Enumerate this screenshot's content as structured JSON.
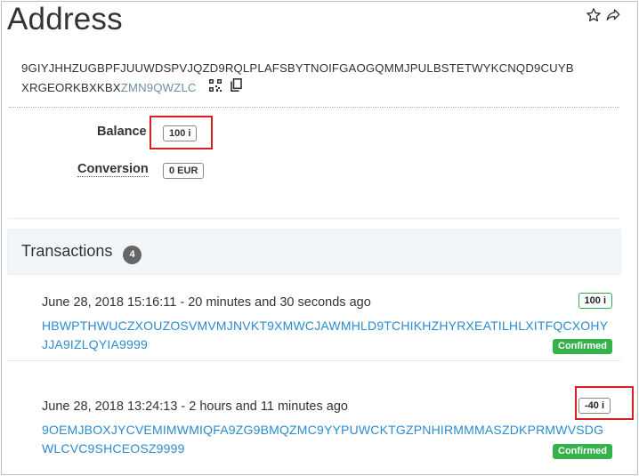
{
  "page": {
    "title": "Address"
  },
  "address": {
    "line1": "9GIYJHHZUGBPFJUUWDSPVJQZD9RQLPLAFSBYTNOIFGAOGQMMJPULBSTETWYKCNQD9CUYB",
    "line2_main": "XRGEORKBXKBX",
    "line2_checksum": "ZMN9QWZLC"
  },
  "balance": {
    "label": "Balance",
    "value": "100 i"
  },
  "conversion": {
    "label": "Conversion",
    "value": "0 EUR"
  },
  "transactions": {
    "label": "Transactions",
    "count": "4",
    "items": [
      {
        "time": "June 28, 2018 15:16:11 - 20 minutes and 30 seconds ago",
        "hash_line1": "HBWPTHWUCZXOUZOSVMVMJNVKT9XMWCJAWMHLD9TCHIKHZHYRXEATILHLXITFQCXOHY",
        "hash_line2": "JJA9IZLQYIA9999",
        "amount": "100 i",
        "status": "Confirmed"
      },
      {
        "time": "June 28, 2018 13:24:13 - 2 hours and 11 minutes ago",
        "hash_line1": "9OEMJBOXJYCVEMIMWMIQFA9ZG9BMQZMC9YYPUWCKTGZPNHIRMMMASZDKPRMWVSDG",
        "hash_line2": "WLCVC9SHCEOSZ9999",
        "amount": "-40 i",
        "status": "Confirmed"
      }
    ]
  },
  "icons": {
    "favorite": "star-outline-icon",
    "share": "share-arrow-icon",
    "qr": "qr-code-icon",
    "copy": "copy-icon"
  },
  "colors": {
    "highlight_box": "#d8201f",
    "link": "#2a8bd0",
    "confirmed": "#36b24a",
    "checksum": "#6b8fb0"
  }
}
